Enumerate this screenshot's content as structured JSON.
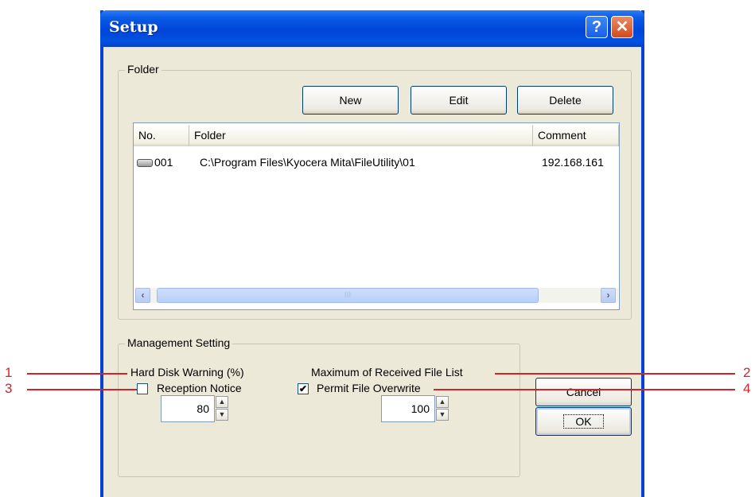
{
  "window": {
    "title": "Setup",
    "help_label": "?",
    "close_label": "✕"
  },
  "folder_group": {
    "legend": "Folder",
    "buttons": {
      "new": "New",
      "edit": "Edit",
      "delete": "Delete"
    },
    "list": {
      "columns": [
        "No.",
        "Folder",
        "Comment"
      ],
      "rows": [
        {
          "no": "001",
          "folder": "C:\\Program Files\\Kyocera Mita\\FileUtility\\01",
          "comment": "192.168.161",
          "icon": "drive-icon"
        }
      ]
    },
    "scrollbar": {
      "left_arrow": "‹",
      "right_arrow": "›",
      "thumb_grip": "III"
    }
  },
  "management_group": {
    "legend": "Management Setting",
    "hard_disk_warning": {
      "label": "Hard Disk Warning (%)",
      "value": "80"
    },
    "max_received_list": {
      "label": "Maximum of Received File List",
      "value": "100"
    },
    "reception_notice": {
      "label": "Reception Notice",
      "checked": false
    },
    "permit_overwrite": {
      "label": "Permit File Overwrite",
      "checked": true,
      "check_glyph": "✔"
    },
    "spin_up": "▲",
    "spin_down": "▼"
  },
  "dialog_buttons": {
    "ok": "OK",
    "cancel": "Cancel"
  },
  "callouts": [
    "1",
    "2",
    "3",
    "4"
  ],
  "colors": {
    "titlebar": "#0052e0",
    "callout": "#d2232a",
    "dialog_bg": "#ece9d8"
  }
}
